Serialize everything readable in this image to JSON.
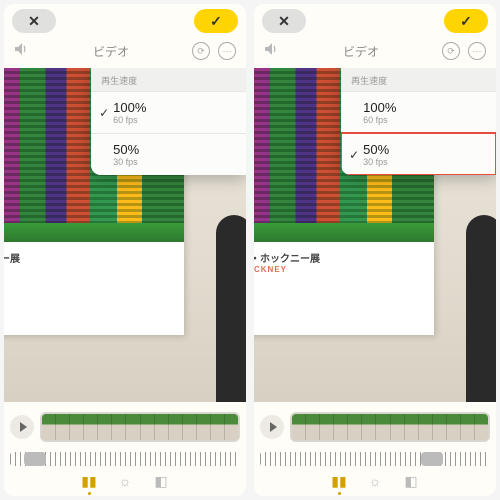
{
  "panels": [
    {
      "tab_label": "ビデオ",
      "popup_header": "再生速度",
      "speeds": [
        {
          "pct": "100%",
          "fps": "60 fps",
          "checked": true
        },
        {
          "pct": "50%",
          "fps": "30 fps",
          "checked": false
        }
      ],
      "highlight_index": -1,
      "poster_jp": "クニー展",
      "poster_en": "",
      "ruler_knob_pct": 6
    },
    {
      "tab_label": "ビデオ",
      "popup_header": "再生速度",
      "speeds": [
        {
          "pct": "100%",
          "fps": "60 fps",
          "checked": false
        },
        {
          "pct": "50%",
          "fps": "30 fps",
          "checked": true
        }
      ],
      "highlight_index": 1,
      "poster_jp": "ッド・ホックニー展",
      "poster_en": "D HOCKNEY",
      "ruler_knob_pct": 70
    }
  ],
  "icons": {
    "close": "✕",
    "confirm": "✓",
    "timer_glyph": "⟳",
    "more_glyph": "⋯",
    "play": "▶"
  }
}
